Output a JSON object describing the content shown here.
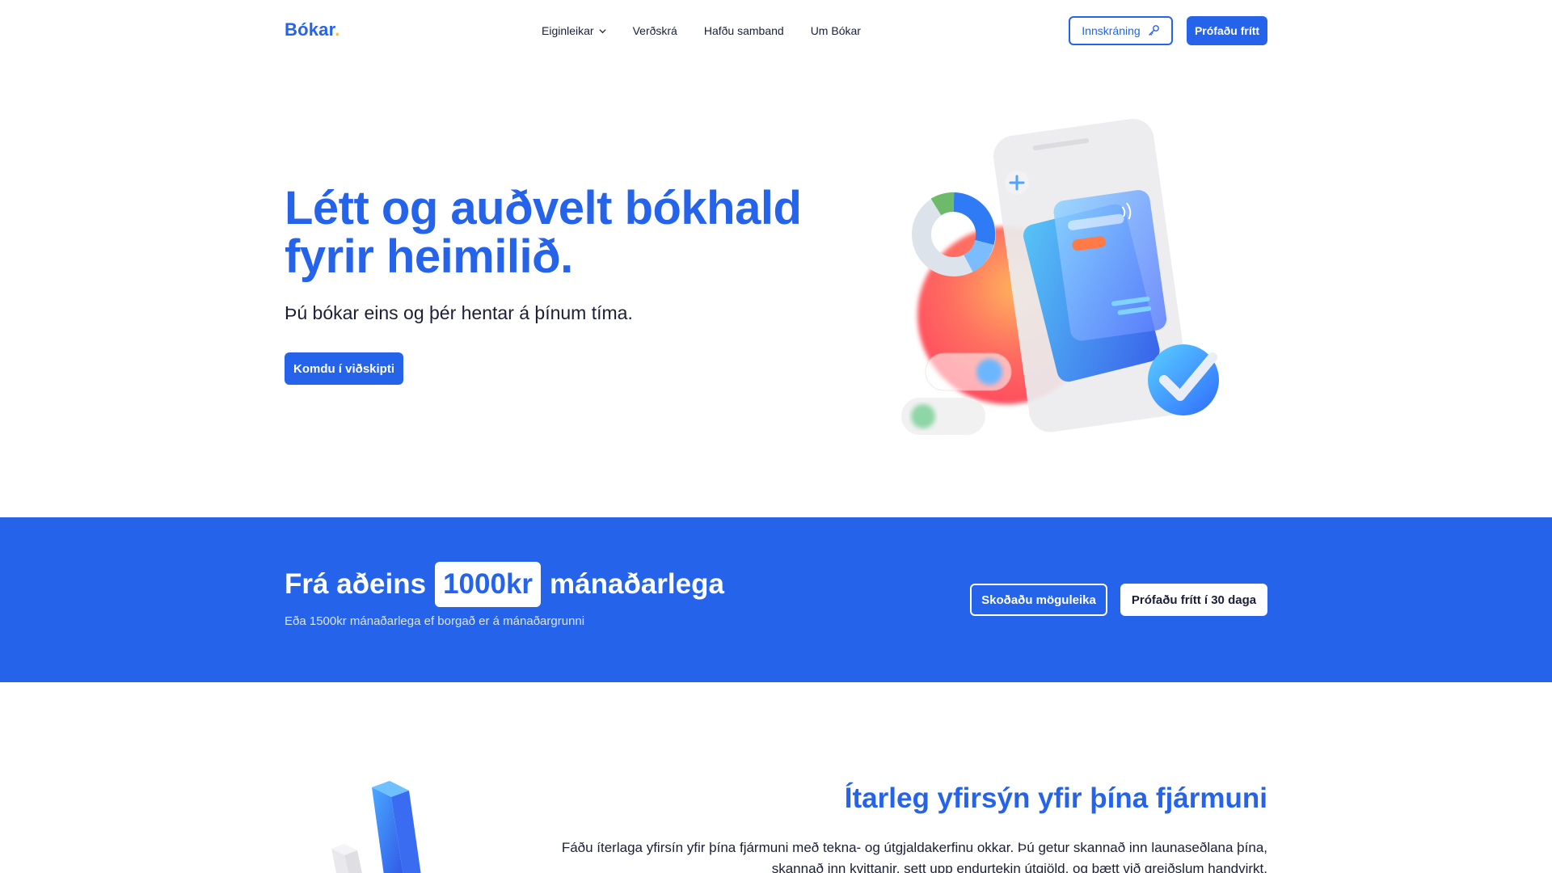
{
  "brand": {
    "name": "Bókar",
    "dot": "."
  },
  "nav": {
    "items": [
      "Eiginleikar",
      "Verðskrá",
      "Hafðu samband",
      "Um Bókar"
    ],
    "login_label": "Innskráning",
    "try_label": "Prófaðu frítt"
  },
  "hero": {
    "title": "Létt og auðvelt bókhald fyrir heimilið.",
    "subtitle": "Þú bókar eins og þér hentar á þínum tíma.",
    "cta": "Komdu í viðskipti"
  },
  "pricing": {
    "prefix": "Frá aðeins",
    "price": "1000kr",
    "suffix": "mánaðarlega",
    "note": "Eða 1500kr mánaðarlega ef borgað er á mánaðargrunni",
    "options_label": "Skoðaðu möguleika",
    "trial_label": "Prófaðu frítt í 30 daga"
  },
  "feature": {
    "title": "Ítarleg yfirsýn yfir þína fjármuni",
    "text": "Fáðu íterlaga yfirsín yfir þína fjármuni með tekna- og útgjaldakerfinu okkar. Þú getur skannað inn launaseðlana þína, skannað inn kvittanir, sett upp endurtekin útgjöld, og bætt við greiðslum handvirkt."
  },
  "colors": {
    "brand": "#2563eb",
    "accent_dot": "#f5c518",
    "text": "#1a1f36"
  },
  "icons": [
    "chevron-down-icon",
    "key-icon",
    "phone-illustration",
    "chart-illustration"
  ]
}
